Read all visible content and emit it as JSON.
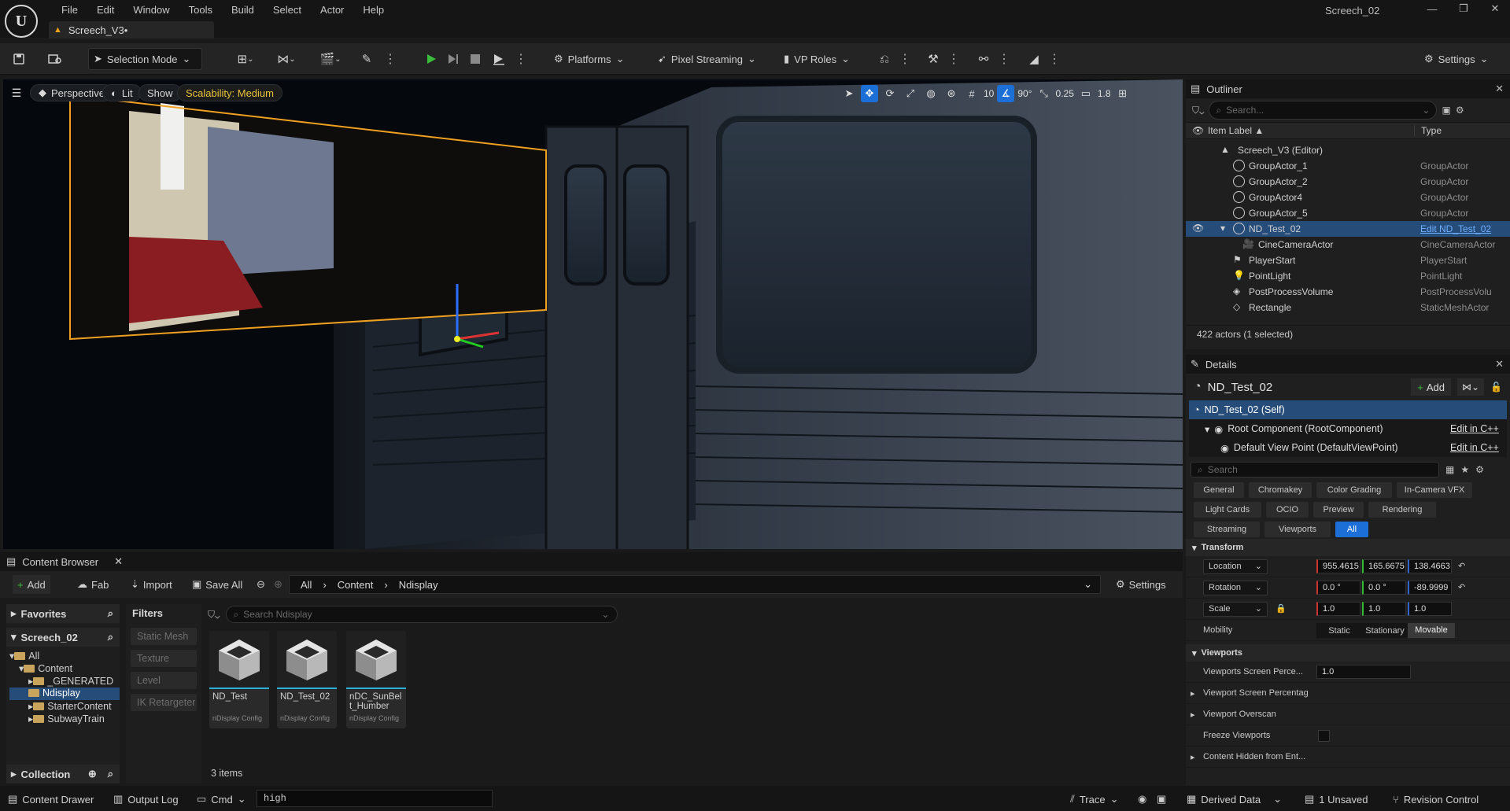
{
  "app": {
    "logo": "U",
    "window_title": "Screech_02",
    "level_tab": "Screech_V3•",
    "window_buttons": [
      "—",
      "❐",
      "✕"
    ]
  },
  "menu": [
    "File",
    "Edit",
    "Window",
    "Tools",
    "Build",
    "Select",
    "Actor",
    "Help"
  ],
  "toolbar": {
    "selection_mode": "Selection Mode",
    "platforms": "Platforms",
    "pixel_streaming": "Pixel Streaming",
    "vp_roles": "VP Roles",
    "settings": "Settings"
  },
  "viewport": {
    "perspective": "Perspective",
    "lit": "Lit",
    "show": "Show",
    "scalability": "Scalability: Medium",
    "grid_size": "10",
    "rotation_snap": "90°",
    "scale_snap": "0.25",
    "camera_speed": "1.8"
  },
  "outliner": {
    "title": "Outliner",
    "search_placeholder": "Search...",
    "col_label": "Item Label ▲",
    "col_type": "Type",
    "rows": [
      {
        "label": "Screech_V3 (Editor)",
        "type": ""
      },
      {
        "label": "GroupActor_1",
        "type": "GroupActor"
      },
      {
        "label": "GroupActor_2",
        "type": "GroupActor"
      },
      {
        "label": "GroupActor4",
        "type": "GroupActor"
      },
      {
        "label": "GroupActor_5",
        "type": "GroupActor"
      },
      {
        "label": "ND_Test_02",
        "type": "Edit ND_Test_02"
      },
      {
        "label": "CineCameraActor",
        "type": "CineCameraActor"
      },
      {
        "label": "PlayerStart",
        "type": "PlayerStart"
      },
      {
        "label": "PointLight",
        "type": "PointLight"
      },
      {
        "label": "PostProcessVolume",
        "type": "PostProcessVolu"
      },
      {
        "label": "Rectangle",
        "type": "StaticMeshActor"
      }
    ],
    "footer": "422 actors (1 selected)"
  },
  "details": {
    "title": "Details",
    "object_name": "ND_Test_02",
    "add": "Add",
    "components": [
      {
        "label": "ND_Test_02 (Self)",
        "edit": ""
      },
      {
        "label": "Root Component (RootComponent)",
        "edit": "Edit in C++"
      },
      {
        "label": "Default View Point (DefaultViewPoint)",
        "edit": "Edit in C++"
      }
    ],
    "search_placeholder": "Search",
    "categories": [
      "General",
      "Chromakey",
      "Color Grading",
      "In-Camera VFX",
      "Light Cards",
      "OCIO",
      "Preview",
      "Rendering",
      "Streaming",
      "Viewports",
      "All"
    ],
    "transform": {
      "header": "Transform",
      "location_label": "Location",
      "location": [
        "955.4615",
        "165.6675",
        "138.4663"
      ],
      "rotation_label": "Rotation",
      "rotation": [
        "0.0 °",
        "0.0 °",
        "-89.9999"
      ],
      "scale_label": "Scale",
      "scale": [
        "1.0",
        "1.0",
        "1.0"
      ],
      "mobility_label": "Mobility",
      "mobility": [
        "Static",
        "Stationary",
        "Movable"
      ]
    },
    "viewports": {
      "header": "Viewports",
      "screen_pct_label": "Viewports Screen Perce...",
      "screen_pct": "1.0",
      "vsp_label": "Viewport Screen Percentag",
      "overscan_label": "Viewport Overscan",
      "freeze_label": "Freeze Viewports",
      "hidden_label": "Content Hidden from Ent..."
    }
  },
  "content_browser": {
    "tab": "Content Browser",
    "add": "Add",
    "fab": "Fab",
    "import": "Import",
    "save_all": "Save All",
    "crumbs": [
      "All",
      "Content",
      "Ndisplay"
    ],
    "settings": "Settings",
    "favorites": "Favorites",
    "project": "Screech_02",
    "tree": [
      "All",
      "Content",
      "_GENERATED",
      "Ndisplay",
      "StarterContent",
      "SubwayTrain"
    ],
    "collection": "Collection",
    "filters_title": "Filters",
    "filters": [
      "Static Mesh",
      "Texture",
      "Level",
      "IK Retargeter"
    ],
    "search_placeholder": "Search Ndisplay",
    "assets": [
      {
        "name": "ND_Test",
        "type": "nDisplay Config"
      },
      {
        "name": "ND_Test_02",
        "type": "nDisplay Config"
      },
      {
        "name": "nDC_SunBelt_Humber",
        "type": "nDisplay Config"
      }
    ],
    "item_count": "3 items"
  },
  "statusbar": {
    "content_drawer": "Content Drawer",
    "output_log": "Output Log",
    "cmd": "Cmd",
    "cmd_value": "high",
    "trace": "Trace",
    "derived_data": "Derived Data",
    "unsaved": "1 Unsaved",
    "revision_control": "Revision Control"
  }
}
